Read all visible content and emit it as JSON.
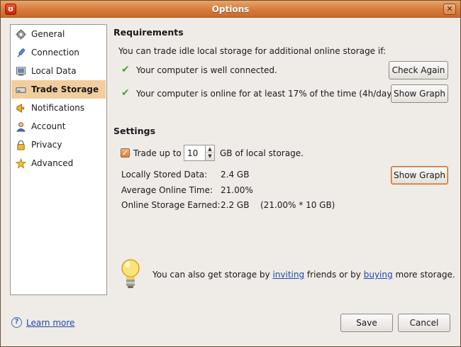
{
  "window": {
    "title": "Options",
    "app_icon": "ubuntu-one-icon",
    "close_glyph": "✕"
  },
  "sidebar": {
    "items": [
      {
        "label": "General",
        "icon": "gear-icon"
      },
      {
        "label": "Connection",
        "icon": "plug-icon"
      },
      {
        "label": "Local Data",
        "icon": "drive-icon"
      },
      {
        "label": "Trade Storage",
        "icon": "storage-icon",
        "selected": true
      },
      {
        "label": "Notifications",
        "icon": "megaphone-icon"
      },
      {
        "label": "Account",
        "icon": "person-icon"
      },
      {
        "label": "Privacy",
        "icon": "lock-icon"
      },
      {
        "label": "Advanced",
        "icon": "star-icon"
      }
    ]
  },
  "requirements": {
    "title": "Requirements",
    "intro": "You can trade idle local storage for additional online storage if:",
    "conditions": [
      {
        "text": "Your computer is well connected.",
        "button": "Check Again"
      },
      {
        "text": "Your computer is online for at least 17% of the time (4h/day)",
        "button": "Show Graph"
      }
    ]
  },
  "settings": {
    "title": "Settings",
    "trade_checked": true,
    "trade_prefix": "Trade up to",
    "trade_value": "10",
    "trade_suffix": "GB of local storage.",
    "stats": [
      {
        "label": "Locally Stored Data:",
        "value": "2.4 GB"
      },
      {
        "label": "Average Online Time:",
        "value": "21.00%"
      },
      {
        "label": "Online Storage Earned:",
        "value": "2.2 GB",
        "extra": "(21.00% * 10 GB)"
      }
    ],
    "graph_button": "Show Graph"
  },
  "tip": {
    "prefix": "You can also get storage by",
    "link1": "inviting",
    "middle": "friends or by",
    "link2": "buying",
    "suffix": "more storage."
  },
  "footer": {
    "learn_more": "Learn more",
    "save": "Save",
    "cancel": "Cancel"
  },
  "colors": {
    "accent": "#d77b3b",
    "selection": "#f2ce9e",
    "check_green": "#4ea233",
    "link": "#1f4aa8"
  }
}
